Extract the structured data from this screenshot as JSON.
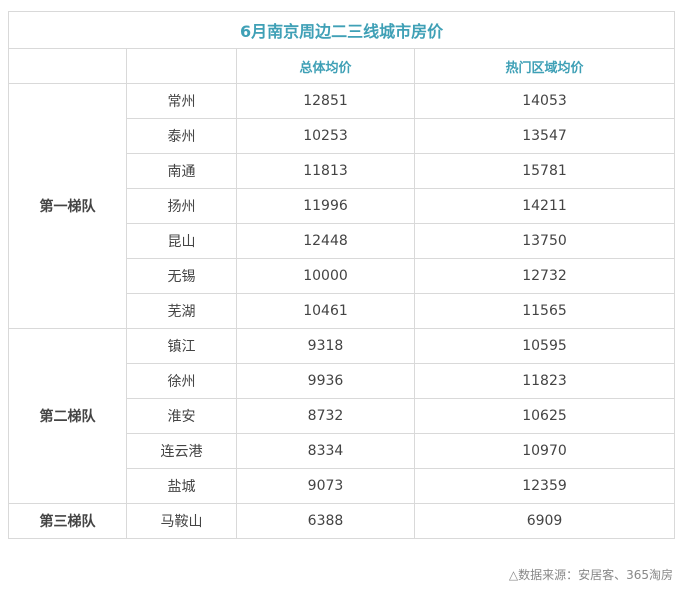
{
  "chart_data": {
    "type": "table",
    "title": "6月南京周边二三线城市房价",
    "columns": [
      "",
      "",
      "总体均价",
      "热门区域均价"
    ],
    "tiers": [
      {
        "name": "第一梯队",
        "rows": [
          {
            "city": "常州",
            "overall": 12851,
            "hot": 14053
          },
          {
            "city": "泰州",
            "overall": 10253,
            "hot": 13547
          },
          {
            "city": "南通",
            "overall": 11813,
            "hot": 15781
          },
          {
            "city": "扬州",
            "overall": 11996,
            "hot": 14211
          },
          {
            "city": "昆山",
            "overall": 12448,
            "hot": 13750
          },
          {
            "city": "无锡",
            "overall": 10000,
            "hot": 12732
          },
          {
            "city": "芜湖",
            "overall": 10461,
            "hot": 11565
          }
        ]
      },
      {
        "name": "第二梯队",
        "rows": [
          {
            "city": "镇江",
            "overall": 9318,
            "hot": 10595
          },
          {
            "city": "徐州",
            "overall": 9936,
            "hot": 11823
          },
          {
            "city": "淮安",
            "overall": 8732,
            "hot": 10625
          },
          {
            "city": "连云港",
            "overall": 8334,
            "hot": 10970
          },
          {
            "city": "盐城",
            "overall": 9073,
            "hot": 12359
          }
        ]
      },
      {
        "name": "第三梯队",
        "rows": [
          {
            "city": "马鞍山",
            "overall": 6388,
            "hot": 6909
          }
        ]
      }
    ]
  },
  "source_note": "△数据来源：安居客、365淘房",
  "colors": {
    "accent": "#3fa0b6",
    "border": "#d9d9d9",
    "text": "#444444",
    "note": "#888888"
  }
}
